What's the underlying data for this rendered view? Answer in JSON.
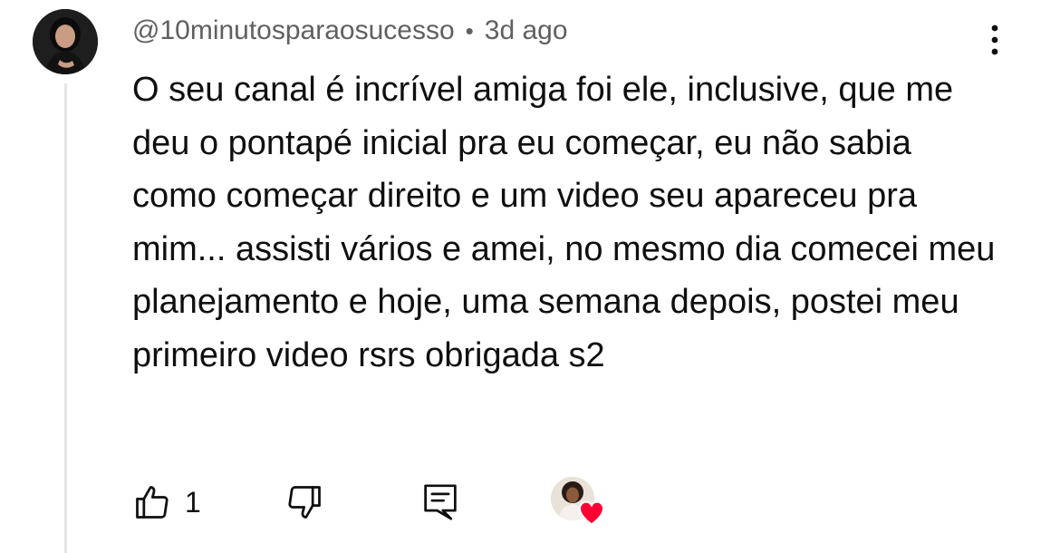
{
  "comment": {
    "author": "@10minutosparaosucesso",
    "separator": "•",
    "time": "3d ago",
    "text": "O seu canal é incrível amiga foi ele, inclusive, que me deu o pontapé inicial pra eu começar, eu não sabia como começar direito e um video seu apareceu pra mim... assisti vários e amei, no mesmo dia comecei meu planejamento e hoje, uma semana depois, postei meu primeiro video rsrs obrigada s2",
    "likes": "1"
  },
  "icons": {
    "like": "thumbs-up-icon",
    "dislike": "thumbs-down-icon",
    "reply": "comment-reply-icon",
    "more": "more-vertical-icon",
    "heart": "heart-icon"
  },
  "colors": {
    "text_primary": "#0f0f0f",
    "text_secondary": "#606060",
    "thread_line": "#e5e5e5",
    "heart": "#ff0033"
  }
}
